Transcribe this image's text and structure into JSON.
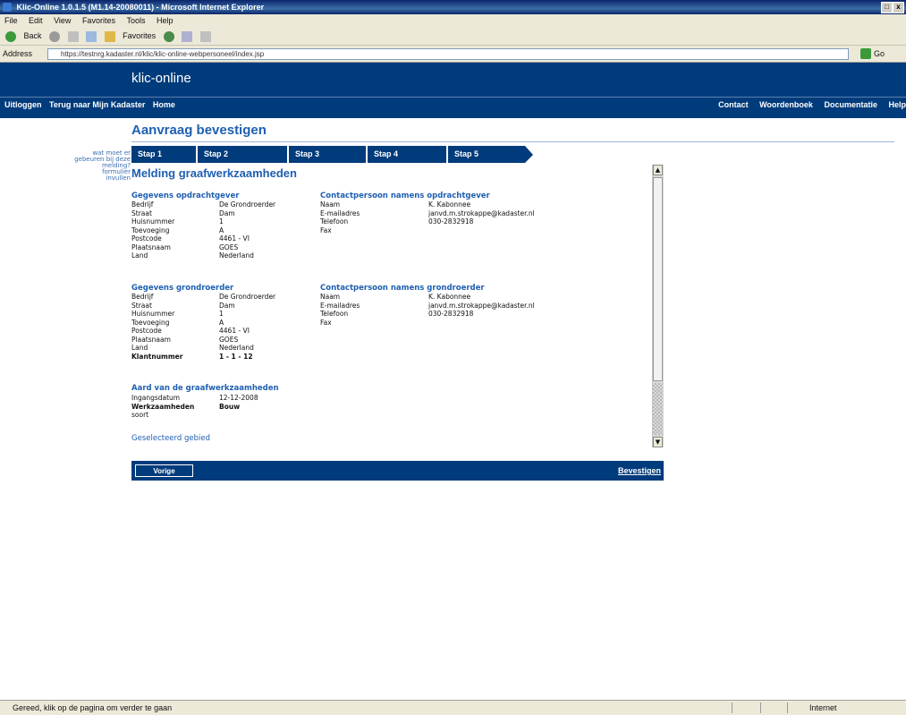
{
  "window": {
    "title": "Klic-Online 1.0.1.5 (M1.14-20080011) - Microsoft Internet Explorer",
    "minimize": "_",
    "maximize": "□",
    "close": "x"
  },
  "menu": [
    "File",
    "Edit",
    "View",
    "Favorites",
    "Tools",
    "Help"
  ],
  "toolbar": {
    "back": "Back",
    "favorites": "Favorites"
  },
  "address": {
    "label": "Address",
    "url": "https://testnrg.kadaster.nl/klic/klic-online-webpersoneel/index.jsp",
    "go": "Go"
  },
  "site": {
    "logo": "klic-online",
    "nav_left": [
      "Uitloggen",
      "Terug naar Mijn Kadaster",
      "Home"
    ],
    "nav_right": [
      "Contact",
      "Woordenboek",
      "Documentatie",
      "Help"
    ]
  },
  "sidebar_links": [
    "wat moet er",
    "gebeuren bij deze",
    "melding?",
    "formulier",
    "invullen"
  ],
  "page": {
    "title": "Aanvraag bevestigen",
    "heading": "Melding graafwerkzaamheden"
  },
  "steps": [
    "Stap 1",
    "Stap 2",
    "Stap 3",
    "Stap 4",
    "Stap 5"
  ],
  "opdrachtgever": {
    "title": "Gegevens opdrachtgever",
    "fields": [
      {
        "k": "Bedrijf",
        "v": "De Grondroerder"
      },
      {
        "k": "Straat",
        "v": "Dam"
      },
      {
        "k": "Huisnummer",
        "v": "1"
      },
      {
        "k": "Toevoeging",
        "v": "A"
      },
      {
        "k": "Postcode",
        "v": "4461 - VI"
      },
      {
        "k": "Plaatsnaam",
        "v": "GOES"
      },
      {
        "k": "Land",
        "v": "Nederland"
      }
    ]
  },
  "contact_opdrachtgever": {
    "title": "Contactpersoon namens opdrachtgever",
    "fields": [
      {
        "k": "Naam",
        "v": "K. Kabonnee"
      },
      {
        "k": "E-mailadres",
        "v": "janvd.m.strokappe@kadaster.nl"
      },
      {
        "k": "Telefoon",
        "v": "030-2832918"
      },
      {
        "k": "Fax",
        "v": ""
      }
    ]
  },
  "grondroerder": {
    "title": "Gegevens grondroerder",
    "fields": [
      {
        "k": "Bedrijf",
        "v": "De Grondroerder"
      },
      {
        "k": "Straat",
        "v": "Dam"
      },
      {
        "k": "Huisnummer",
        "v": "1"
      },
      {
        "k": "Toevoeging",
        "v": "A"
      },
      {
        "k": "Postcode",
        "v": "4461 - VI"
      },
      {
        "k": "Plaatsnaam",
        "v": "GOES"
      },
      {
        "k": "Land",
        "v": "Nederland"
      },
      {
        "k": "Klantnummer",
        "v": "1 - 1 - 12"
      }
    ]
  },
  "contact_grondroerder": {
    "title": "Contactpersoon namens grondroerder",
    "fields": [
      {
        "k": "Naam",
        "v": "K. Kabonnee"
      },
      {
        "k": "E-mailadres",
        "v": "janvd.m.strokappe@kadaster.nl"
      },
      {
        "k": "Telefoon",
        "v": "030-2832918"
      },
      {
        "k": "Fax",
        "v": ""
      }
    ]
  },
  "werkzaamheden": {
    "title": "Aard van de graafwerkzaamheden",
    "fields": [
      {
        "k": "Ingangsdatum",
        "v": "12-12-2008"
      },
      {
        "k": "Werkzaamheden",
        "v": "Bouw"
      },
      {
        "k": "soort",
        "v": ""
      }
    ]
  },
  "link_geselecteerd": "Geselecteerd gebied",
  "footer": {
    "prev": "Vorige",
    "confirm": "Bevestigen"
  },
  "statusbar": {
    "text": "Gereed, klik op de pagina om verder te gaan",
    "zone": "Internet"
  }
}
